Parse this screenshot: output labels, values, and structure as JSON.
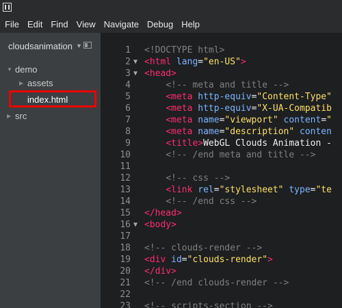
{
  "menu": [
    "File",
    "Edit",
    "Find",
    "View",
    "Navigate",
    "Debug",
    "Help"
  ],
  "sidebar": {
    "project": "cloudsanimation",
    "tree": [
      {
        "label": "demo",
        "type": "folder-open"
      },
      {
        "label": "assets",
        "type": "folder-closed"
      },
      {
        "label": "index.html",
        "type": "file",
        "selected": true
      },
      {
        "label": "src",
        "type": "folder-closed"
      }
    ]
  },
  "colors": {
    "tag": "#ff2d6e",
    "attr": "#7db5ff",
    "string": "#ffe066",
    "comment": "#808080",
    "selection": "#e00000"
  },
  "editor": {
    "lines": [
      {
        "n": "1",
        "fold": "",
        "tokens": [
          [
            "comment",
            "<!DOCTYPE html>"
          ]
        ]
      },
      {
        "n": "2",
        "fold": "▼",
        "tokens": [
          [
            "tag",
            "<html"
          ],
          [
            "text",
            " "
          ],
          [
            "attr",
            "lang"
          ],
          [
            "text",
            "="
          ],
          [
            "str",
            "\"en-US\""
          ],
          [
            "tag",
            ">"
          ]
        ]
      },
      {
        "n": "3",
        "fold": "▼",
        "tokens": [
          [
            "tag",
            "<head>"
          ]
        ]
      },
      {
        "n": "4",
        "fold": "",
        "tokens": [
          [
            "text",
            "    "
          ],
          [
            "comment",
            "<!-- meta and title -->"
          ]
        ]
      },
      {
        "n": "5",
        "fold": "",
        "tokens": [
          [
            "text",
            "    "
          ],
          [
            "tag",
            "<meta"
          ],
          [
            "text",
            " "
          ],
          [
            "attr",
            "http-equiv"
          ],
          [
            "text",
            "="
          ],
          [
            "str",
            "\"Content-Type\""
          ]
        ]
      },
      {
        "n": "6",
        "fold": "",
        "tokens": [
          [
            "text",
            "    "
          ],
          [
            "tag",
            "<meta"
          ],
          [
            "text",
            " "
          ],
          [
            "attr",
            "http-equiv"
          ],
          [
            "text",
            "="
          ],
          [
            "str",
            "\"X-UA-Compatib"
          ]
        ]
      },
      {
        "n": "7",
        "fold": "",
        "tokens": [
          [
            "text",
            "    "
          ],
          [
            "tag",
            "<meta"
          ],
          [
            "text",
            " "
          ],
          [
            "attr",
            "name"
          ],
          [
            "text",
            "="
          ],
          [
            "str",
            "\"viewport\""
          ],
          [
            "text",
            " "
          ],
          [
            "attr",
            "content"
          ],
          [
            "text",
            "="
          ],
          [
            "str",
            "\""
          ]
        ]
      },
      {
        "n": "8",
        "fold": "",
        "tokens": [
          [
            "text",
            "    "
          ],
          [
            "tag",
            "<meta"
          ],
          [
            "text",
            " "
          ],
          [
            "attr",
            "name"
          ],
          [
            "text",
            "="
          ],
          [
            "str",
            "\"description\""
          ],
          [
            "text",
            " "
          ],
          [
            "attr",
            "conten"
          ]
        ]
      },
      {
        "n": "9",
        "fold": "",
        "tokens": [
          [
            "text",
            "    "
          ],
          [
            "tag",
            "<title>"
          ],
          [
            "text",
            "WebGL Clouds Animation -"
          ]
        ]
      },
      {
        "n": "10",
        "fold": "",
        "tokens": [
          [
            "text",
            "    "
          ],
          [
            "comment",
            "<!-- /end meta and title -->"
          ]
        ]
      },
      {
        "n": "11",
        "fold": "",
        "tokens": []
      },
      {
        "n": "12",
        "fold": "",
        "tokens": [
          [
            "text",
            "    "
          ],
          [
            "comment",
            "<!-- css -->"
          ]
        ]
      },
      {
        "n": "13",
        "fold": "",
        "tokens": [
          [
            "text",
            "    "
          ],
          [
            "tag",
            "<link"
          ],
          [
            "text",
            " "
          ],
          [
            "attr",
            "rel"
          ],
          [
            "text",
            "="
          ],
          [
            "str",
            "\"stylesheet\""
          ],
          [
            "text",
            " "
          ],
          [
            "attr",
            "type"
          ],
          [
            "text",
            "="
          ],
          [
            "str",
            "\"te"
          ]
        ]
      },
      {
        "n": "14",
        "fold": "",
        "tokens": [
          [
            "text",
            "    "
          ],
          [
            "comment",
            "<!-- /end css -->"
          ]
        ]
      },
      {
        "n": "15",
        "fold": "",
        "tokens": [
          [
            "tag",
            "</head>"
          ]
        ]
      },
      {
        "n": "16",
        "fold": "▼",
        "tokens": [
          [
            "tag",
            "<body>"
          ]
        ]
      },
      {
        "n": "17",
        "fold": "",
        "tokens": []
      },
      {
        "n": "18",
        "fold": "",
        "tokens": [
          [
            "comment",
            "<!-- clouds-render -->"
          ]
        ]
      },
      {
        "n": "19",
        "fold": "",
        "tokens": [
          [
            "tag",
            "<div"
          ],
          [
            "text",
            " "
          ],
          [
            "attr",
            "id"
          ],
          [
            "text",
            "="
          ],
          [
            "str",
            "\"clouds-render\""
          ],
          [
            "tag",
            ">"
          ]
        ]
      },
      {
        "n": "20",
        "fold": "",
        "tokens": [
          [
            "tag",
            "</div>"
          ]
        ]
      },
      {
        "n": "21",
        "fold": "",
        "tokens": [
          [
            "comment",
            "<!-- /end clouds-render -->"
          ]
        ]
      },
      {
        "n": "22",
        "fold": "",
        "tokens": []
      },
      {
        "n": "23",
        "fold": "",
        "tokens": [
          [
            "comment",
            "<!-- scripts-section -->"
          ]
        ]
      }
    ]
  }
}
